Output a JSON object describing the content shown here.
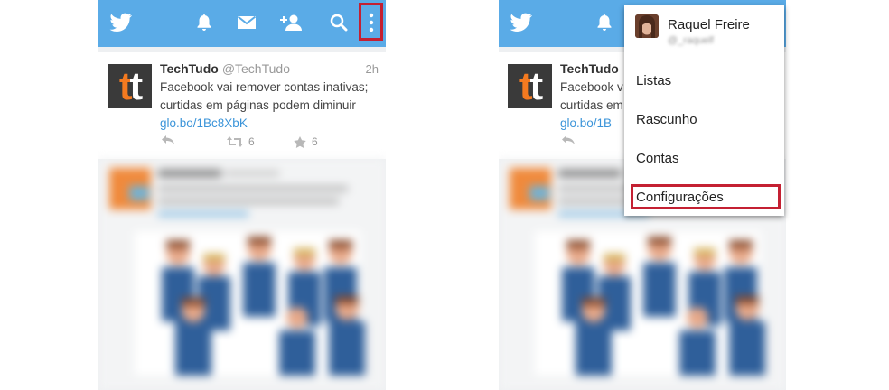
{
  "tweet": {
    "author": "TechTudo",
    "handle": "@TechTudo",
    "time": "2h",
    "text_line1": "Facebook vai remover contas inativas;",
    "text_line2": "curtidas em páginas podem diminuir",
    "text_line1_partial": "Facebook v",
    "text_line2_partial": "curtidas em",
    "link": "glo.bo/1Bc8XbK",
    "link_partial": "glo.bo/1B",
    "retweets": "6",
    "favorites": "6",
    "avatar_text_left": "t",
    "avatar_text_right": "t"
  },
  "menu": {
    "profile_name": "Raquel Freire",
    "profile_handle": "@_raquelf",
    "items": [
      "Listas",
      "Rascunho",
      "Contas",
      "Configurações"
    ]
  },
  "colors": {
    "topbar": "#5aabe7",
    "highlight": "#c42032",
    "link": "#3b94d9"
  },
  "icons": [
    "twitter-bird-icon",
    "bell-icon",
    "mail-icon",
    "add-user-icon",
    "search-icon",
    "overflow-menu-icon",
    "reply-icon",
    "retweet-icon",
    "favorite-star-icon"
  ]
}
